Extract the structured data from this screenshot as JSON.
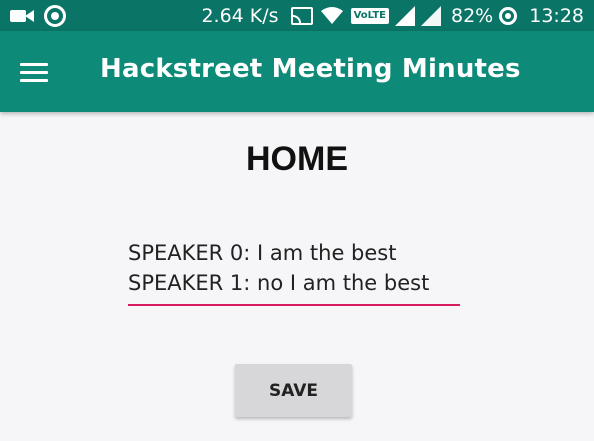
{
  "status_bar": {
    "network_speed": "2.64 K/s",
    "volte_badge": "VoLTE",
    "battery_percent": "82%",
    "time": "13:28",
    "icons": [
      "video-icon",
      "record-icon",
      "cast-icon",
      "wifi-icon",
      "volte-icon",
      "signal-icon",
      "signal-icon-2",
      "battery-saver-icon"
    ]
  },
  "app_bar": {
    "title": "Hackstreet Meeting Minutes",
    "menu_icon": "menu-icon"
  },
  "main": {
    "heading": "HOME",
    "transcript_text": "SPEAKER 0: I am the best\nSPEAKER 1: no I am the best",
    "save_label": "SAVE"
  },
  "colors": {
    "status_bar_bg": "#0a7466",
    "app_bar_bg": "#0e8a78",
    "underline_accent": "#d81b60",
    "button_bg": "#d7d6d8",
    "page_bg": "#f6f5f7"
  }
}
